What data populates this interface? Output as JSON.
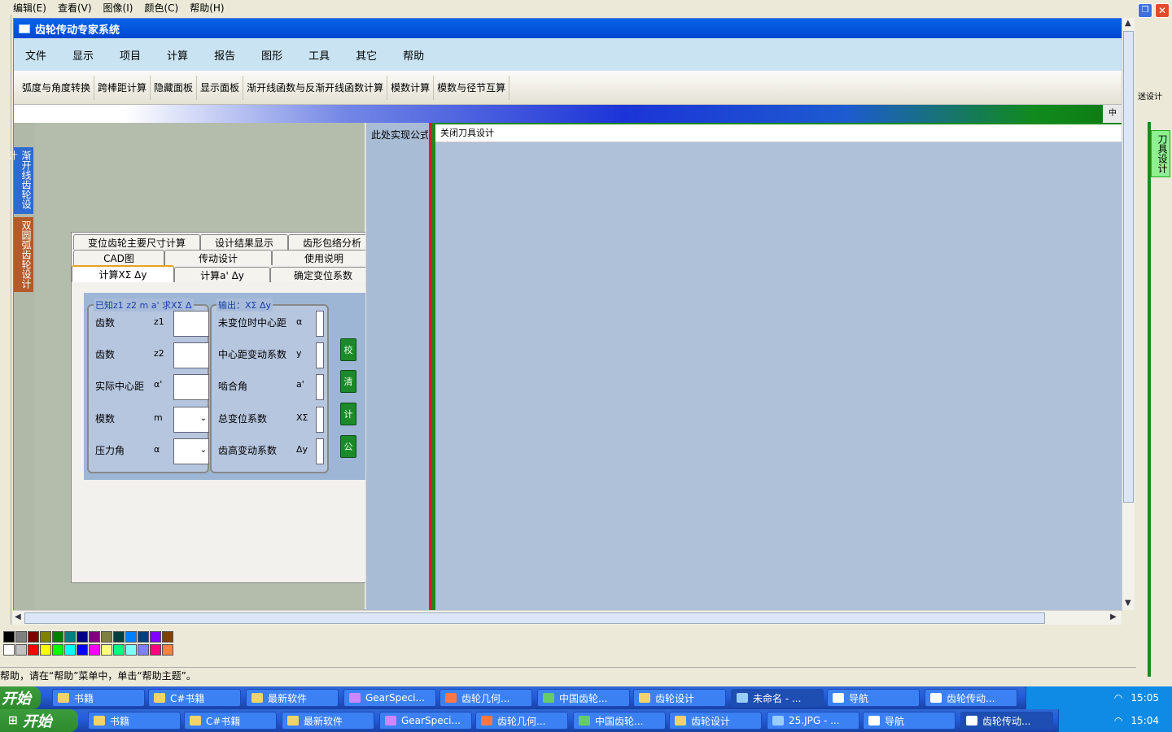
{
  "outer_menu": [
    "编辑(E)",
    "查看(V)",
    "图像(I)",
    "颜色(C)",
    "帮助(H)"
  ],
  "window": {
    "title": "齿轮传动专家系统"
  },
  "menu": [
    "文件",
    "显示",
    "项目",
    "计算",
    "报告",
    "图形",
    "工具",
    "其它",
    "帮助"
  ],
  "toolbar": [
    "弧度与角度转换",
    "跨棒距计算",
    "隐藏面板",
    "显示面板",
    "渐开线函数与反渐开线函数计算",
    "模数计算",
    "模数与径节互算"
  ],
  "gradient_tab": "中",
  "side_tabs": [
    "渐开线齿轮设计",
    "双圆弧齿轮设计"
  ],
  "tabs_row1": [
    "变位齿轮主要尺寸计算",
    "设计结果显示",
    "齿形包络分析"
  ],
  "tabs_row2": [
    "CAD图",
    "传动设计",
    "使用说明"
  ],
  "tabs_row3": [
    "计算XΣ Δy",
    "计算a' Δy",
    "确定变位系数"
  ],
  "input_group": {
    "label": "已知z1 z2 m a' 求XΣ Δ",
    "rows": [
      {
        "label": "齿数",
        "sym": "z1"
      },
      {
        "label": "齿数",
        "sym": "z2"
      },
      {
        "label": "实际中心距",
        "sym": "α'"
      },
      {
        "label": "模数",
        "sym": "m"
      },
      {
        "label": "压力角",
        "sym": "α"
      }
    ]
  },
  "output_group": {
    "label": "输出：XΣ Δy",
    "rows": [
      {
        "label": "未变位时中心距",
        "sym": "α"
      },
      {
        "label": "中心距变动系数",
        "sym": "y"
      },
      {
        "label": "啮合角",
        "sym": "a'"
      },
      {
        "label": "总变位系数",
        "sym": "XΣ"
      },
      {
        "label": "齿高变动系数",
        "sym": "Δy"
      }
    ]
  },
  "green_buttons": [
    "校",
    "清",
    "计",
    "公"
  ],
  "mid_label": "此处实现公式",
  "right_header": "关闭刀具设计",
  "right_side_tab": "刀具设计",
  "right_side_text": "迷设计",
  "status": "帮助，请在“帮助”菜单中，单击“帮助主题”。",
  "colors": {
    "palette_row1": [
      "#000000",
      "#808080",
      "#800000",
      "#808000",
      "#008000",
      "#008080",
      "#000080",
      "#800080",
      "#808040",
      "#004040",
      "#0080ff",
      "#004080",
      "#8000ff",
      "#804000"
    ],
    "palette_row2": [
      "#ffffff",
      "#c0c0c0",
      "#ff0000",
      "#ffff00",
      "#00ff00",
      "#00ffff",
      "#0000ff",
      "#ff00ff",
      "#ffff80",
      "#00ff80",
      "#80ffff",
      "#8080ff",
      "#ff0080",
      "#ff8040"
    ]
  },
  "taskbar1": {
    "start": "开始",
    "items": [
      "书籍",
      "C#书籍",
      "最新软件",
      "GearSpeci...",
      "齿轮几何...",
      "中国齿轮...",
      "齿轮设计",
      "未命名 - ...",
      "导航",
      "齿轮传动..."
    ],
    "time": "15:05"
  },
  "taskbar2": {
    "start": "开始",
    "items": [
      "书籍",
      "C#书籍",
      "最新软件",
      "GearSpeci...",
      "齿轮几何...",
      "中国齿轮...",
      "齿轮设计",
      "25.JPG - ...",
      "导航",
      "齿轮传动..."
    ],
    "time": "15:04"
  }
}
